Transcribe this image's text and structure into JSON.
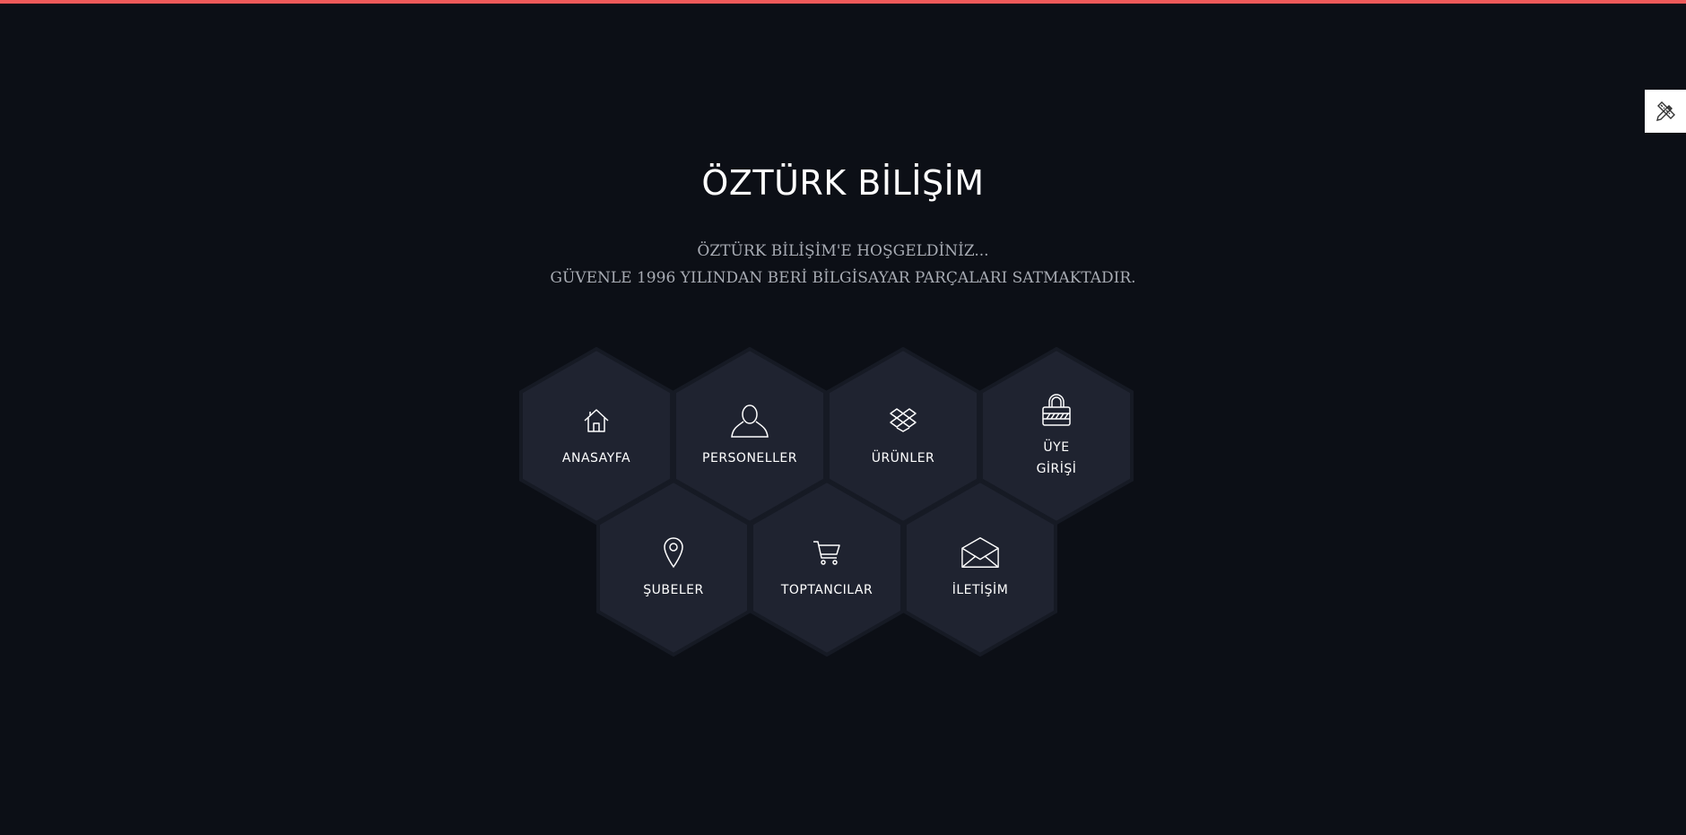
{
  "page": {
    "title": "ÖZTÜRK BİLİŞİM",
    "subtitle_line1": "ÖZTÜRK BİLİŞİM'E HOŞGELDİNİZ...",
    "subtitle_line2": "GÜVENLE 1996 YILINDAN BERİ BİLGİSAYAR PARÇALARI SATMAKTADIR."
  },
  "colors": {
    "background": "#0c0f16",
    "accent_bar": "#f05a5a",
    "hex_fill": "#1f2330",
    "hex_border": "#161a24",
    "text": "#ffffff",
    "subtitle": "#a7abb3"
  },
  "nav": {
    "items": [
      {
        "label": "ANASAYFA",
        "icon": "home-icon"
      },
      {
        "label": "PERSONELLER",
        "icon": "user-icon"
      },
      {
        "label": "ÜRÜNLER",
        "icon": "dropbox-icon"
      },
      {
        "label": "ÜYE\nGİRİŞİ",
        "icon": "lock-icon"
      },
      {
        "label": "ŞUBELER",
        "icon": "map-pin-icon"
      },
      {
        "label": "TOPTANCILAR",
        "icon": "cart-icon"
      },
      {
        "label": "İLETİŞİM",
        "icon": "envelope-icon"
      }
    ]
  },
  "tool": {
    "icon": "pencil-ruler-icon"
  }
}
